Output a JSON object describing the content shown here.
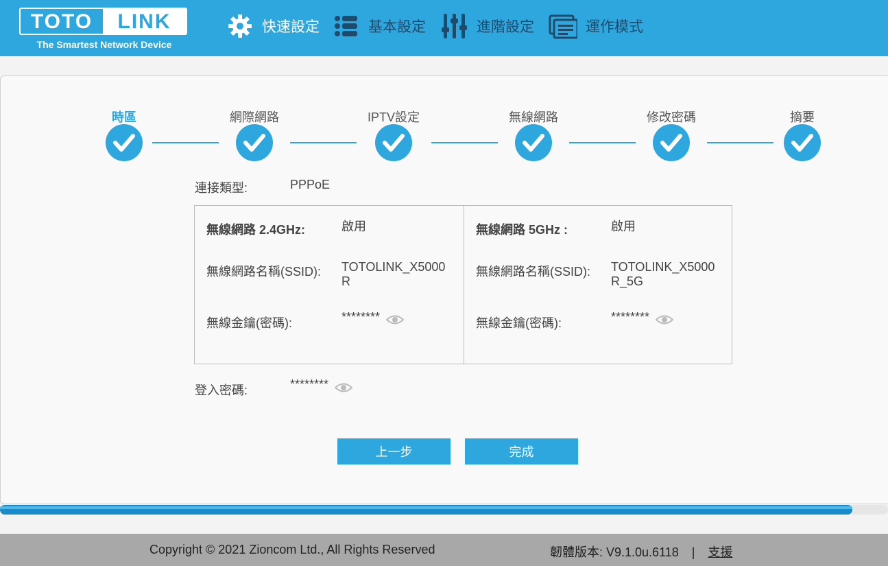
{
  "header": {
    "logo_left": "TOTO",
    "logo_right": "LINK",
    "logo_tagline": "The Smartest Network Device",
    "nav": [
      {
        "label": "快速設定",
        "icon": "gear-icon",
        "active": true
      },
      {
        "label": "基本設定",
        "icon": "list-icon",
        "active": false
      },
      {
        "label": "進階設定",
        "icon": "sliders-icon",
        "active": false
      },
      {
        "label": "運作模式",
        "icon": "mode-icon",
        "active": false
      }
    ]
  },
  "steps": [
    {
      "label": "時區",
      "current": true
    },
    {
      "label": "網際網路",
      "current": false
    },
    {
      "label": "IPTV設定",
      "current": false
    },
    {
      "label": "無線網路",
      "current": false
    },
    {
      "label": "修改密碼",
      "current": false
    },
    {
      "label": "摘要",
      "current": false
    }
  ],
  "summary": {
    "connection_label": "連接類型:",
    "connection_value": "PPPoE",
    "wifi24": {
      "title": "無線網路 2.4GHz:",
      "status": "啟用",
      "ssid_label": "無線網路名稱(SSID):",
      "ssid_value": "TOTOLINK_X5000R",
      "key_label": "無線金鑰(密碼):",
      "key_value": "********"
    },
    "wifi5": {
      "title": "無線網路 5GHz :",
      "status": "啟用",
      "ssid_label": "無線網路名稱(SSID):",
      "ssid_value": "TOTOLINK_X5000R_5G",
      "key_label": "無線金鑰(密碼):",
      "key_value": "********"
    },
    "login_label": "登入密碼:",
    "login_value": "********"
  },
  "buttons": {
    "prev": "上一步",
    "finish": "完成"
  },
  "progress": 0.96,
  "footer": {
    "copyright": "Copyright © 2021 Zioncom Ltd., All Rights Reserved",
    "firmware": "韌體版本: V9.1.0u.6118",
    "separator": "|",
    "support": "支援"
  }
}
